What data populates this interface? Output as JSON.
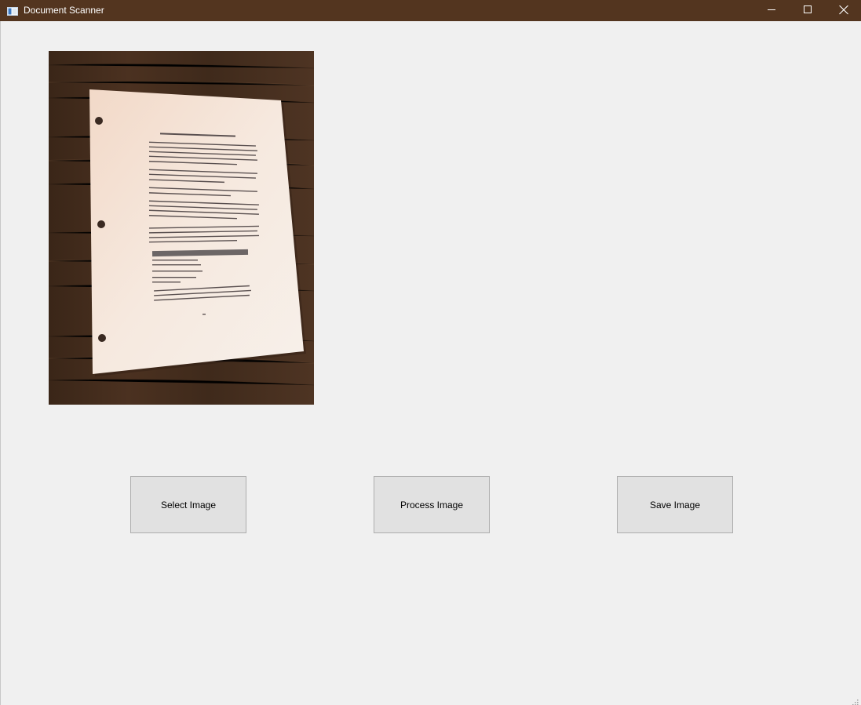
{
  "window": {
    "title": "Document Scanner",
    "titlebar_color": "#53351f",
    "controls": {
      "minimize_icon": "minimize-icon",
      "maximize_icon": "maximize-icon",
      "close_icon": "close-icon"
    }
  },
  "preview": {
    "image_icon": "photo-of-paper-document-on-wooden-table",
    "document": {
      "heading": "CAMERA SCANNER TEST DOCUMENT",
      "paragraphs": [
        "On this page is an example of a document that can be scanned using a phone camera and converted into a flat image.",
        "Place the document on a dark surface and take the photo from above.",
        "The outline of the page is detected automatically.",
        "After locating the four corners, a perspective transform is applied to produce a top-down view of the page.",
        "Adaptive thresholding is used to give the result a scanned black and white appearance."
      ],
      "highlight": "Steps in the pipeline",
      "list": [
        "1. Detect edges",
        "2. Find contours",
        "3. Apply perspective transform",
        "4. Threshold image"
      ],
      "closing": "The final image can then be saved to disk and shared like any other scanned document."
    }
  },
  "actions": {
    "select_label": "Select Image",
    "process_label": "Process Image",
    "save_label": "Save Image"
  },
  "status": {
    "resize_grip_icon": "resize-grip-icon"
  }
}
